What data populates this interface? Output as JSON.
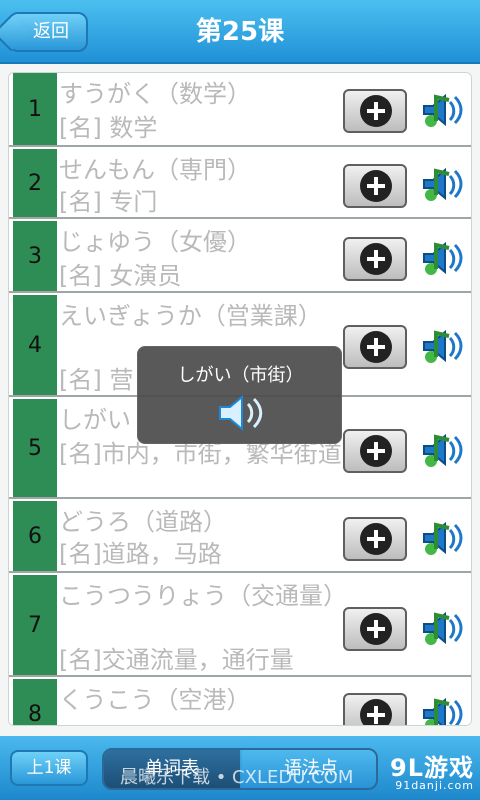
{
  "header": {
    "back_label": "返回",
    "title": "第25课"
  },
  "lesson_items": [
    {
      "num": "1",
      "word": "すうがく（数学）",
      "meaning": "[名] 数学"
    },
    {
      "num": "2",
      "word": "せんもん（専門）",
      "meaning": "[名] 专门"
    },
    {
      "num": "3",
      "word": "じょゆう（女優）",
      "meaning": "[名] 女演员"
    },
    {
      "num": "4",
      "word": "えいぎょうか（営業課）",
      "meaning": "[名] 营"
    },
    {
      "num": "5",
      "word": "しがい",
      "meaning": "[名]市内，市街，繁华街道"
    },
    {
      "num": "6",
      "word": "どうろ（道路）",
      "meaning": "[名]道路，马路"
    },
    {
      "num": "7",
      "word": "こうつうりょう（交通量）",
      "meaning": "[名]交通流量，通行量"
    },
    {
      "num": "8",
      "word": "くうこう（空港）",
      "meaning": ""
    }
  ],
  "popup": {
    "text": "しがい（市街）"
  },
  "bottom": {
    "prev_label": "上1课",
    "tab_vocab": "单词表",
    "tab_grammar": "语法点",
    "logo": "9L游戏",
    "logo_domain": "91danji.com",
    "watermark": "晨曦乐下载 • CXLEDU.COM"
  },
  "colors": {
    "header_blue": "#2b9ae0",
    "row_number_green": "#2e8d54",
    "text_gray": "#b9b9b9"
  }
}
